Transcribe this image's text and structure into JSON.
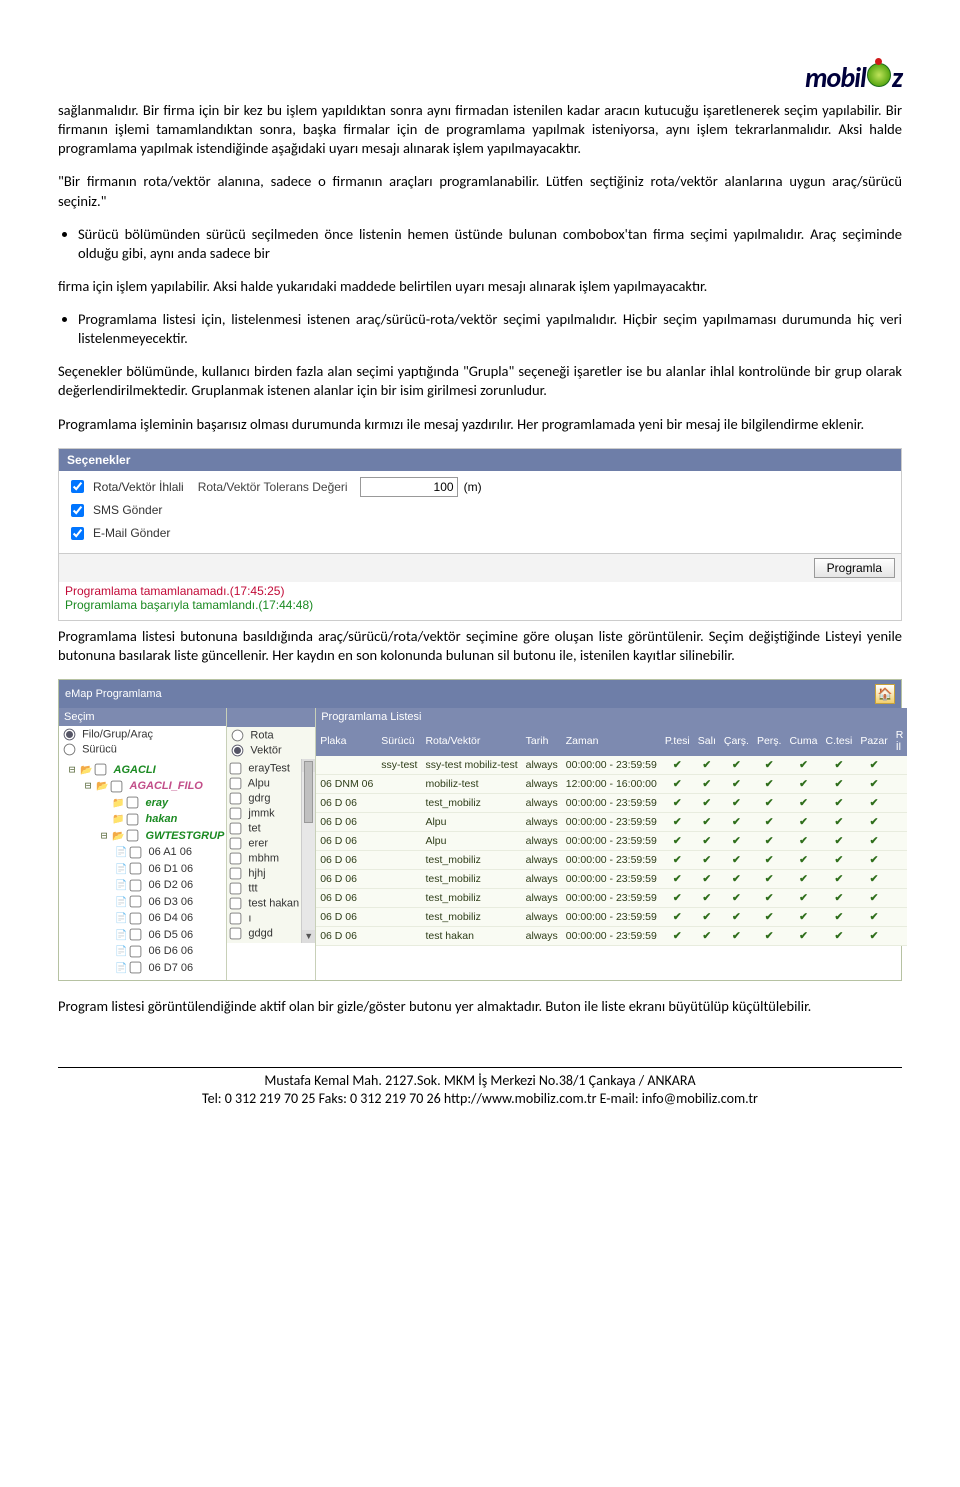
{
  "logo": {
    "part1": "mobil",
    "part2": "z"
  },
  "paragraphs": {
    "p1": "sağlanmalıdır. Bir firma için bir kez bu işlem yapıldıktan sonra aynı firmadan istenilen kadar aracın kutucuğu işaretlenerek seçim yapılabilir. Bir firmanın işlemi tamamlandıktan sonra, başka firmalar için de programlama yapılmak isteniyorsa, aynı işlem tekrarlanmalıdır. Aksi halde programlama yapılmak istendiğinde aşağıdaki uyarı mesajı alınarak işlem yapılmayacaktır.",
    "quote": "\"Bir firmanın rota/vektör alanına,  sadece o firmanın araçları programlanabilir. Lütfen seçtiğiniz rota/vektör alanlarına uygun araç/sürücü seçiniz.\"",
    "b1": "Sürücü bölümünden sürücü seçilmeden önce listenin hemen üstünde bulunan combobox'tan firma seçimi yapılmalıdır. Araç seçiminde olduğu gibi, aynı anda sadece bir",
    "b1c": "firma için işlem yapılabilir. Aksi halde yukarıdaki maddede belirtilen uyarı mesajı alınarak işlem yapılmayacaktır.",
    "b2": "Programlama listesi için, listelenmesi istenen araç/sürücü-rota/vektör seçimi yapılmalıdır. Hiçbir seçim yapılmaması durumunda hiç veri listelenmeyecektir.",
    "p2": "Seçenekler bölümünde, kullanıcı birden fazla alan seçimi yaptığında \"Grupla\" seçeneği işaretler ise bu alanlar ihlal kontrolünde bir grup olarak değerlendirilmektedir. Gruplanmak istenen alanlar için bir isim girilmesi zorunludur.",
    "p3": "Programlama işleminin başarısız olması durumunda kırmızı ile mesaj yazdırılır. Her programlamada yeni bir mesaj ile bilgilendirme eklenir.",
    "p4": "Programlama listesi butonuna basıldığında araç/sürücü/rota/vektör seçimine göre oluşan liste görüntülenir. Seçim değiştiğinde Listeyi yenile butonuna basılarak liste güncellenir. Her kaydın en son kolonunda bulunan sil butonu ile, istenilen kayıtlar silinebilir.",
    "p5": "Program listesi görüntülendiğinde aktif olan bir gizle/göster butonu yer almaktadır. Buton ile liste ekranı büyütülüp küçültülebilir."
  },
  "panel_secenekler": {
    "title": "Seçenekler",
    "cb1": "Rota/Vektör İhlali",
    "tol_label": "Rota/Vektör Tolerans Değeri",
    "tol_value": "100",
    "tol_unit": "(m)",
    "cb2": "SMS Gönder",
    "cb3": "E-Mail Gönder",
    "btn": "Programla",
    "msg_err": "Programlama tamamlanamadı.(17:45:25)",
    "msg_ok": "Programlama başarıyla tamamlandı.(17:44:48)"
  },
  "emap": {
    "title": "eMap Programlama",
    "col_a": {
      "header": "Seçim",
      "r1": "Filo/Grup/Araç",
      "r2": "Sürücü",
      "tree": [
        {
          "lvl": 1,
          "exp": "⊟",
          "folderOpen": true,
          "chk": false,
          "label": "AGACLI",
          "cls": "colA-name"
        },
        {
          "lvl": 2,
          "exp": "⊟",
          "folderOpen": true,
          "chk": false,
          "label": "AGACLI_FILO",
          "cls": "colA-name2"
        },
        {
          "lvl": 3,
          "exp": "",
          "folderOpen": null,
          "chk": false,
          "label": "eray",
          "cls": "colA-name"
        },
        {
          "lvl": 3,
          "exp": "",
          "folderOpen": null,
          "chk": false,
          "label": "hakan",
          "cls": "colA-name"
        },
        {
          "lvl": 3,
          "exp": "⊟",
          "folderOpen": true,
          "chk": false,
          "label": "GWTESTGRUP",
          "cls": "colA-name"
        }
      ],
      "files": [
        "06 A1 06",
        "06 D1 06",
        "06 D2 06",
        "06 D3 06",
        "06 D4 06",
        "06 D5 06",
        "06 D6 06",
        "06 D7 06"
      ]
    },
    "col_b": {
      "r1": "Rota",
      "r2": "Vektör",
      "items": [
        "erayTest",
        "Alpu",
        "gdrg",
        "jmmk",
        "tet",
        "erer",
        "mbhm",
        "hjhj",
        "ttt",
        "test hakan",
        "ı",
        "gdgd"
      ]
    },
    "col_c": {
      "header": "Programlama Listesi",
      "cols": [
        "Plaka",
        "Sürücü",
        "Rota/Vektör",
        "Tarih",
        "Zaman",
        "P.tesi",
        "Salı",
        "Çarş.",
        "Perş.",
        "Cuma",
        "C.tesi",
        "Pazar",
        "R İl"
      ],
      "rows": [
        {
          "p": "",
          "s": "ssy-test",
          "r": "ssy-test mobiliz-test",
          "t": "always",
          "z": "00:00:00 - 23:59:59"
        },
        {
          "p": "06 DNM 06",
          "s": "",
          "r": "mobiliz-test",
          "t": "always",
          "z": "12:00:00 - 16:00:00"
        },
        {
          "p": "06 D 06",
          "s": "",
          "r": "test_mobiliz",
          "t": "always",
          "z": "00:00:00 - 23:59:59"
        },
        {
          "p": "06 D 06",
          "s": "",
          "r": "Alpu",
          "t": "always",
          "z": "00:00:00 - 23:59:59"
        },
        {
          "p": "06 D 06",
          "s": "",
          "r": "Alpu",
          "t": "always",
          "z": "00:00:00 - 23:59:59"
        },
        {
          "p": "06 D 06",
          "s": "",
          "r": "test_mobiliz",
          "t": "always",
          "z": "00:00:00 - 23:59:59"
        },
        {
          "p": "06 D 06",
          "s": "",
          "r": "test_mobiliz",
          "t": "always",
          "z": "00:00:00 - 23:59:59"
        },
        {
          "p": "06 D 06",
          "s": "",
          "r": "test_mobiliz",
          "t": "always",
          "z": "00:00:00 - 23:59:59"
        },
        {
          "p": "06 D 06",
          "s": "",
          "r": "test_mobiliz",
          "t": "always",
          "z": "00:00:00 - 23:59:59"
        },
        {
          "p": "06 D 06",
          "s": "",
          "r": "test hakan",
          "t": "always",
          "z": "00:00:00 - 23:59:59"
        }
      ]
    }
  },
  "footer": {
    "l1": "Mustafa Kemal Mah. 2127.Sok. MKM İş Merkezi No.38/1 Çankaya / ANKARA",
    "l2": "Tel: 0 312 219 70 25 Faks: 0 312 219 70 26  http://www.mobiliz.com.tr  E-mail: info@mobiliz.com.tr"
  }
}
